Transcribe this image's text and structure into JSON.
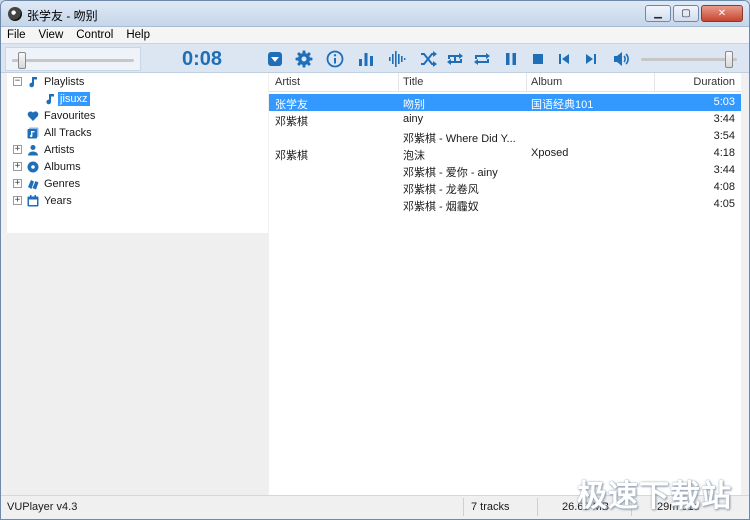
{
  "window": {
    "title": "张学友 - 吻别"
  },
  "menu": [
    {
      "label": "File"
    },
    {
      "label": "View"
    },
    {
      "label": "Control"
    },
    {
      "label": "Help"
    }
  ],
  "toolbar": {
    "time": "0:08",
    "seek_position": 0.05,
    "volume": 0.95
  },
  "sidebar": {
    "playlists": "Playlists",
    "playlist_item": "jisuxz",
    "favourites": "Favourites",
    "all_tracks": "All Tracks",
    "artists": "Artists",
    "albums": "Albums",
    "genres": "Genres",
    "years": "Years"
  },
  "columns": {
    "artist": "Artist",
    "title": "Title",
    "album": "Album",
    "duration": "Duration"
  },
  "tracks": [
    {
      "artist": "张学友",
      "title": "吻别",
      "album": "国语经典101",
      "duration": "5:03"
    },
    {
      "artist": "邓紫棋",
      "title": "ainy",
      "album": "",
      "duration": "3:44"
    },
    {
      "artist": "",
      "title": "邓紫棋 - Where Did Y...",
      "album": "",
      "duration": "3:54"
    },
    {
      "artist": "邓紫棋",
      "title": "泡沫",
      "album": "Xposed",
      "duration": "4:18"
    },
    {
      "artist": "",
      "title": "邓紫棋 - 爱你 - ainy",
      "album": "",
      "duration": "3:44"
    },
    {
      "artist": "",
      "title": "邓紫棋 - 龙卷风",
      "album": "",
      "duration": "4:08"
    },
    {
      "artist": "",
      "title": "邓紫棋 - 烟霾奴",
      "album": "",
      "duration": "4:05"
    }
  ],
  "status": {
    "version": "VUPlayer v4.3",
    "tracks": "7 tracks",
    "size": "26.63 MB",
    "total": "29m 01s"
  },
  "watermark": "极速下载站",
  "colors": {
    "accent": "#1f6fb8",
    "selection": "#3399ff"
  }
}
